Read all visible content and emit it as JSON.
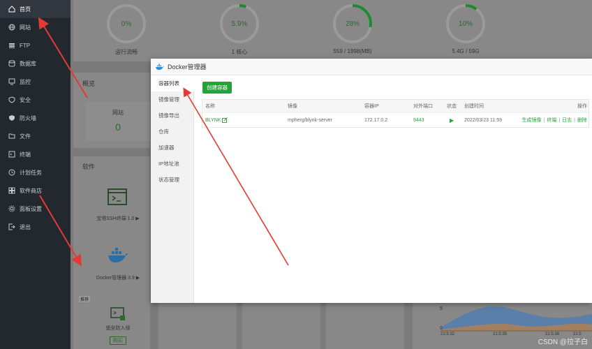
{
  "sidebar": {
    "items": [
      {
        "label": "首页",
        "icon": "home-icon",
        "active": true
      },
      {
        "label": "网站",
        "icon": "globe-icon"
      },
      {
        "label": "FTP",
        "icon": "ftp-icon"
      },
      {
        "label": "数据库",
        "icon": "database-icon"
      },
      {
        "label": "监控",
        "icon": "monitor-icon"
      },
      {
        "label": "安全",
        "icon": "shield-icon"
      },
      {
        "label": "防火墙",
        "icon": "firewall-icon"
      },
      {
        "label": "文件",
        "icon": "folder-icon"
      },
      {
        "label": "终端",
        "icon": "terminal-icon"
      },
      {
        "label": "计划任务",
        "icon": "clock-icon"
      },
      {
        "label": "软件商店",
        "icon": "store-icon"
      },
      {
        "label": "面板设置",
        "icon": "gear-icon"
      },
      {
        "label": "退出",
        "icon": "logout-icon"
      }
    ]
  },
  "dashboard": {
    "gauges": [
      {
        "value": "0%",
        "caption": "运行流畅",
        "fraction": 0.0
      },
      {
        "value": "5.9%",
        "caption": "1 核心",
        "fraction": 0.059
      },
      {
        "value": "28%",
        "caption": "559 / 1998(MB)",
        "fraction": 0.28
      },
      {
        "value": "10%",
        "caption": "5.4G / 59G",
        "fraction": 0.1
      }
    ],
    "overview_title": "概览",
    "site_label": "网站",
    "site_count": "0",
    "software_title": "软件",
    "software": [
      {
        "label": "宝塔SSH终端 1.0 ▶"
      },
      {
        "label": "Docker管理器 3.9 ▶"
      },
      {
        "label": "堡垒防入侵"
      }
    ],
    "badge_recommend": "推荐",
    "buy_label": "购买",
    "chart_ticks_y": [
      "5",
      "0"
    ],
    "chart_ticks_x": [
      "21:5:32",
      "21:5:35",
      "21:5:38",
      "21:5"
    ]
  },
  "modal": {
    "title": "Docker管理器",
    "tabs": [
      "容器列表",
      "镜像管理",
      "镜像导出",
      "仓库",
      "加速器",
      "IP地址池",
      "状态管理"
    ],
    "active_tab": 0,
    "create_button": "创建容器",
    "table": {
      "headers": [
        "名称",
        "镜像",
        "容器IP",
        "对外端口",
        "状态",
        "创建时间",
        "操作"
      ],
      "rows": [
        {
          "name": "BLYNK",
          "image": "mpherg/blynk-server",
          "ip": "172.17.0.2",
          "port": "9443",
          "status": "▶",
          "created": "2022/03/23 11:59",
          "ops": [
            "生成镜像",
            "终端",
            "日志",
            "删除"
          ]
        }
      ]
    }
  },
  "watermark": "CSDN @拉子白",
  "colors": {
    "accent": "#20a53a",
    "sidebar": "#23282f",
    "arrow": "#e53935"
  }
}
